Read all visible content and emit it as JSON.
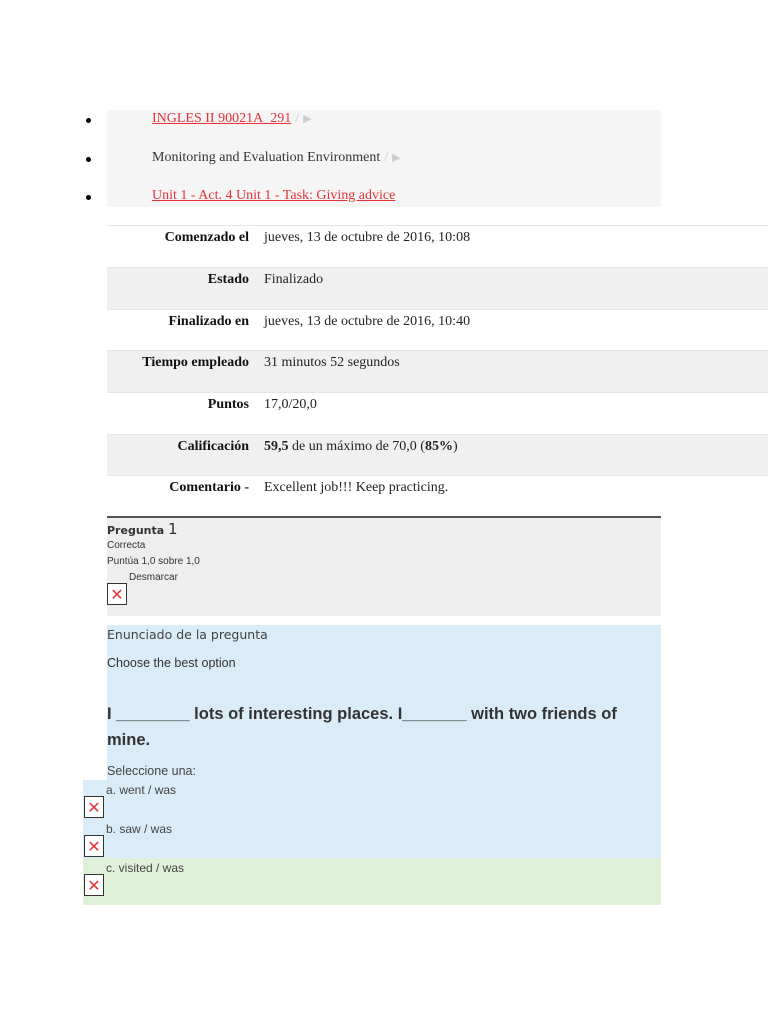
{
  "breadcrumb": [
    {
      "label": "INGLES II 90021A_291",
      "sep": "/",
      "arrow": "▶"
    },
    {
      "label": "Monitoring and Evaluation Environment",
      "sep": "/",
      "arrow": "▶"
    },
    {
      "label": "Unit 1 - Act. 4 Unit 1 - Task: Giving advice"
    }
  ],
  "summary": [
    {
      "label": "Comenzado el",
      "value": "jueves, 13 de octubre de 2016, 10:08"
    },
    {
      "label": "Estado",
      "value": "Finalizado"
    },
    {
      "label": "Finalizado en",
      "value": "jueves, 13 de octubre de 2016, 10:40"
    },
    {
      "label": "Tiempo empleado",
      "value": "31 minutos 52 segundos"
    },
    {
      "label": "Puntos",
      "value": "17,0/20,0"
    },
    {
      "label": "Calificación",
      "grade": "59,5",
      "mid": " de un máximo de 70,0 (",
      "pct": "85%",
      "end": ")"
    },
    {
      "label": "Comentario -",
      "value": "Excellent job!!! Keep practicing."
    }
  ],
  "question": {
    "title": "Pregunta",
    "number": "1",
    "status": "Correcta",
    "score": "Puntúa 1,0 sobre 1,0",
    "unflag": "Desmarcar",
    "heading": "Enunciado de la pregunta",
    "instruction": "Choose the best option",
    "text": "I ________ lots of interesting places. I_______ with two friends of mine.",
    "select": "Seleccione una:",
    "options": [
      "a. went / was",
      "b. saw / was",
      "c. visited / was"
    ]
  },
  "colors": {
    "link": "#e4333a",
    "question_bg": "#d9ecf7",
    "correct_bg": "#dff0d8"
  }
}
